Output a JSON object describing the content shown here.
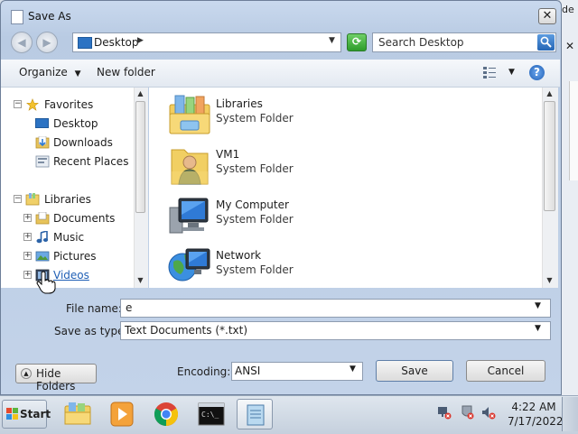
{
  "background": {
    "partial_text": "de"
  },
  "dialog": {
    "title": "Save As",
    "address": {
      "location": "Desktop"
    },
    "search": {
      "placeholder": "Search Desktop"
    },
    "toolbar": {
      "organize_label": "Organize",
      "new_folder_label": "New folder",
      "help_symbol": "?"
    },
    "nav_tree": {
      "favorites": {
        "label": "Favorites",
        "items": [
          "Desktop",
          "Downloads",
          "Recent Places"
        ]
      },
      "libraries": {
        "label": "Libraries",
        "items": [
          "Documents",
          "Music",
          "Pictures",
          "Videos"
        ]
      }
    },
    "files": [
      {
        "name": "Libraries",
        "type": "System Folder",
        "icon": "libraries-icon"
      },
      {
        "name": "VM1",
        "type": "System Folder",
        "icon": "user-folder-icon"
      },
      {
        "name": "My Computer",
        "type": "System Folder",
        "icon": "computer-icon"
      },
      {
        "name": "Network",
        "type": "System Folder",
        "icon": "network-icon"
      }
    ],
    "file_name": {
      "label": "File name:",
      "value": "e"
    },
    "save_as_type": {
      "label": "Save as type:",
      "value": "Text Documents (*.txt)"
    },
    "hide_folders_label": "Hide Folders",
    "encoding": {
      "label": "Encoding:",
      "value": "ANSI"
    },
    "save_label": "Save",
    "cancel_label": "Cancel"
  },
  "taskbar": {
    "start_label": "Start",
    "apps": [
      "file-explorer-icon",
      "media-player-icon",
      "chrome-icon",
      "command-prompt-icon",
      "notepad-icon"
    ],
    "clock": {
      "time": "4:22 AM",
      "date": "7/17/2022"
    }
  },
  "colors": {
    "accent": "#2c73c3",
    "link": "#1f5fb5",
    "dialog_frame": "#c3d3e9"
  }
}
